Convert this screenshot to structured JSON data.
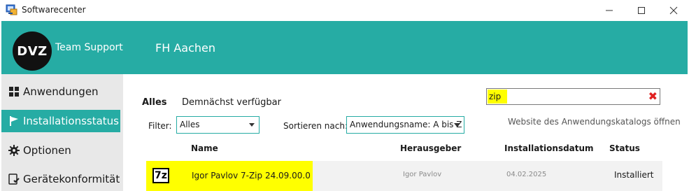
{
  "window": {
    "title": "Softwarecenter",
    "icon": "softwarecenter-icon",
    "controls": {
      "minimize": "—",
      "maximize": "☐",
      "close": "✕"
    }
  },
  "header": {
    "logo_text": "DVZ",
    "brand": "Team Support",
    "organization": "FH Aachen",
    "accent_color": "#26aca4"
  },
  "sidebar": {
    "items": [
      {
        "label": "Anwendungen",
        "icon": "grid-icon",
        "active": false
      },
      {
        "label": "Installationsstatus",
        "icon": "flag-icon",
        "active": true
      },
      {
        "label": "Optionen",
        "icon": "gear-icon",
        "active": false
      },
      {
        "label": "Gerätekonformität",
        "icon": "device-compliance-icon",
        "active": false
      }
    ]
  },
  "main": {
    "tabs": [
      {
        "label": "Alles",
        "selected": true
      },
      {
        "label": "Demnächst verfügbar",
        "selected": false
      }
    ],
    "search": {
      "value": "zip",
      "clear_icon": "✖",
      "highlight_color": "#ffff00"
    },
    "filter": {
      "label": "Filter:",
      "value": "Alles"
    },
    "sort": {
      "label": "Sortieren nach:",
      "value": "Anwendungsname: A bis Z"
    },
    "catalog_link": "Website des Anwendungskatalogs öffnen",
    "columns": {
      "name": "Name",
      "publisher": "Herausgeber",
      "install_date": "Installationsdatum",
      "status": "Status"
    },
    "rows": [
      {
        "icon_text": "7z",
        "name": "Igor Pavlov 7-Zip 24.09.00.0",
        "publisher": "Igor Pavlov",
        "install_date": "04.02.2025",
        "status": "Installiert"
      }
    ]
  }
}
